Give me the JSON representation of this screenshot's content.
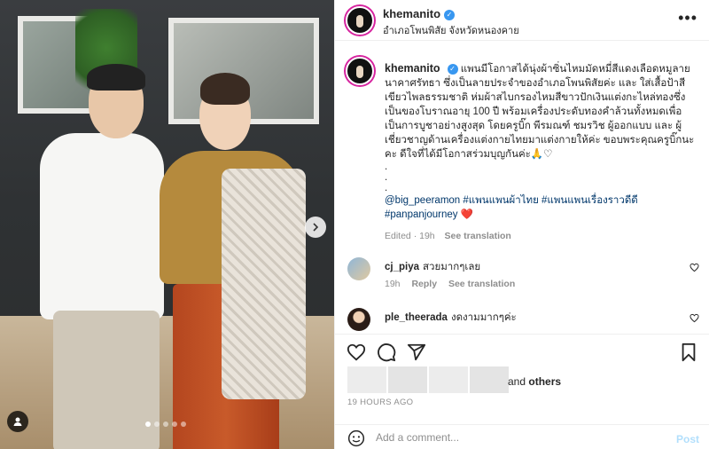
{
  "post": {
    "username": "khemanito",
    "location": "อำเภอโพนพิสัย จังหวัดหนองคาย",
    "more_icon": "more-options-icon"
  },
  "caption": {
    "username": "khemanito",
    "text": "แพนมีโอกาสได้นุ่งผ้าซิ่นไหมมัดหมี่สีแดงเลือดหมูลายนาคาศรัทธา ซึ่งเป็นลายประจำของอำเภอโพนพิสัยค่ะ และ ใส่เสื้อป้าสีเขียวไพลธรรมชาติ ห่มผ้าสไบกรองไหมสีขาวปักเงินแต่งกะไหล่ทองซึ่งเป็นของโบราณอายุ 100 ปี พร้อมเครื่องประดับทองคำล้วนทั้งหมดเพื่อเป็นการบูชาอย่างสูงสุด โดยครูบิ๊ก พีรมณฑ์ ชมรวิช ผู้ออกแบบ และ ผู้เชี่ยวชาญด้านเครื่องแต่งกายไทยมาแต่งกายให้ค่ะ ขอบพระคุณครูบิ๊กนะคะ ดีใจที่ได้มีโอกาสร่วมบุญกันค่ะ🙏♡",
    "dots": [
      ".",
      ".",
      "."
    ],
    "mention": "@big_peeramon",
    "tag1": "#แพนแพนผ้าไทย",
    "tag2": "#แพนแพนเรื่องราวดีดี",
    "tag3": "#panpanjourney",
    "heart": "❤️",
    "edited": "Edited · 19h",
    "see_translation": "See translation"
  },
  "comments": [
    {
      "username": "cj_piya",
      "text": "สวยมากๆเลย",
      "time": "19h",
      "reply": "Reply",
      "see_translation": "See translation"
    },
    {
      "username": "ple_theerada",
      "text": "งดงามมากๆค่ะ"
    }
  ],
  "likes": {
    "text_prefix": "and",
    "others": "others"
  },
  "timestamp": "19 HOURS AGO",
  "add_comment": {
    "placeholder": "Add a comment...",
    "post": "Post"
  },
  "icons": [
    "heart-icon",
    "comment-icon",
    "share-icon",
    "bookmark-icon",
    "emoji-icon",
    "chevron-right-icon",
    "user-tag-icon"
  ],
  "colors": {
    "verified": "#3897f0",
    "link": "#00376b",
    "post_disabled": "#b2dffc"
  },
  "carousel": {
    "slides": 5,
    "active": 1
  }
}
